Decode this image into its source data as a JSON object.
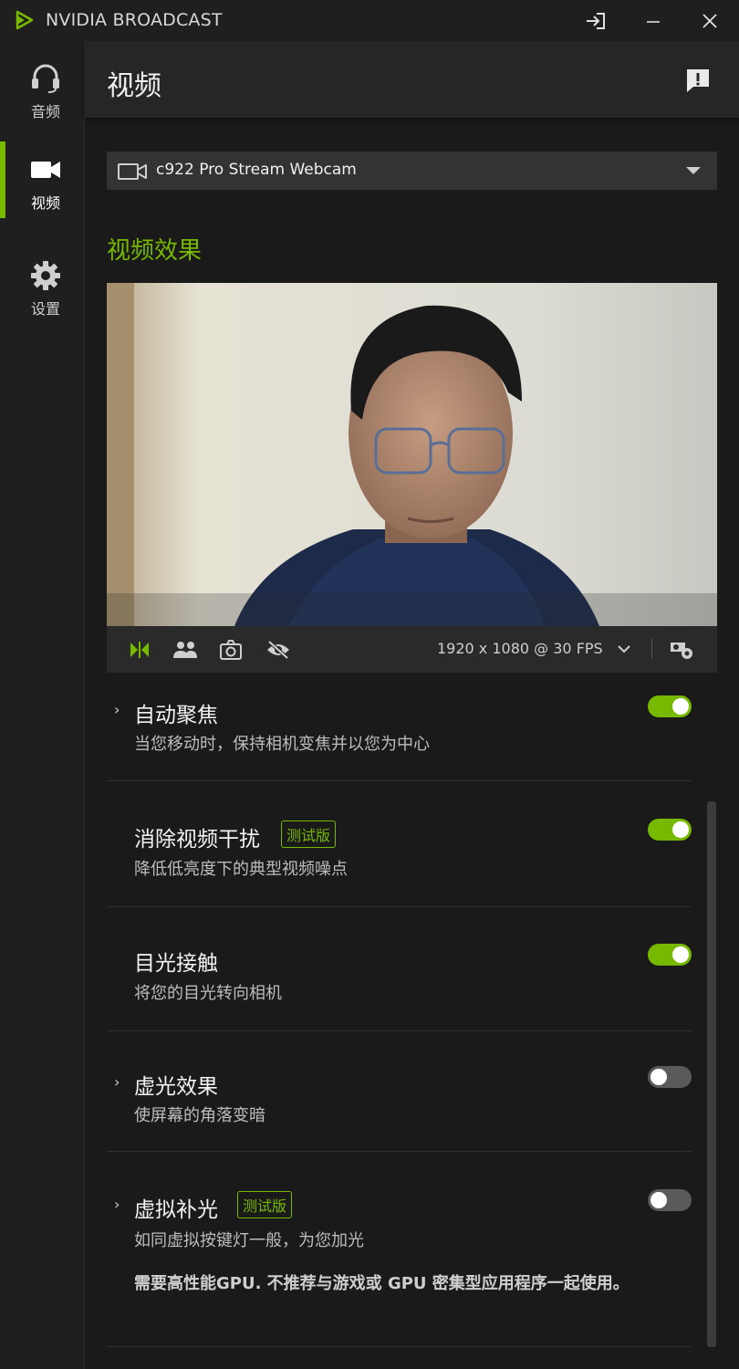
{
  "app": {
    "title": "NVIDIA BROADCAST",
    "accent_color": "#76b900"
  },
  "window_controls": [
    {
      "icon": "sign-in-icon"
    },
    {
      "icon": "minimize-icon"
    },
    {
      "icon": "close-icon"
    }
  ],
  "sidebar": {
    "items": [
      {
        "label": "音频",
        "icon": "headset-icon",
        "active": false
      },
      {
        "label": "视频",
        "icon": "video-camera-icon",
        "active": true
      },
      {
        "label": "设置",
        "icon": "gear-icon",
        "active": false
      }
    ]
  },
  "header": {
    "title": "视频",
    "feedback_icon": "feedback-icon"
  },
  "device": {
    "selected": "c922 Pro Stream Webcam"
  },
  "section": {
    "title": "视频效果"
  },
  "toolbar": {
    "resolution": "1920 x 1080 @ 30 FPS",
    "icons": [
      "side-by-side-icon",
      "people-icon",
      "camera-rotate-icon",
      "eye-off-icon",
      "camera-settings-icon"
    ]
  },
  "effects": [
    {
      "name": "自动聚焦",
      "desc": "当您移动时，保持相机变焦并以您为中心",
      "expandable": true,
      "beta": "",
      "enabled": true
    },
    {
      "name": "消除视频干扰",
      "desc": "降低低亮度下的典型视频噪点",
      "expandable": false,
      "beta": "测试版",
      "enabled": true
    },
    {
      "name": "目光接触",
      "desc": "将您的目光转向相机",
      "expandable": false,
      "beta": "",
      "enabled": true
    },
    {
      "name": "虚光效果",
      "desc": "使屏幕的角落变暗",
      "expandable": true,
      "beta": "",
      "enabled": false
    },
    {
      "name": "虚拟补光",
      "desc": "如同虚拟按键灯一般，为您加光",
      "expandable": true,
      "beta": "测试版",
      "enabled": false,
      "note": "需要高性能GPU. 不推荐与游戏或 GPU 密集型应用程序一起使用。"
    }
  ]
}
